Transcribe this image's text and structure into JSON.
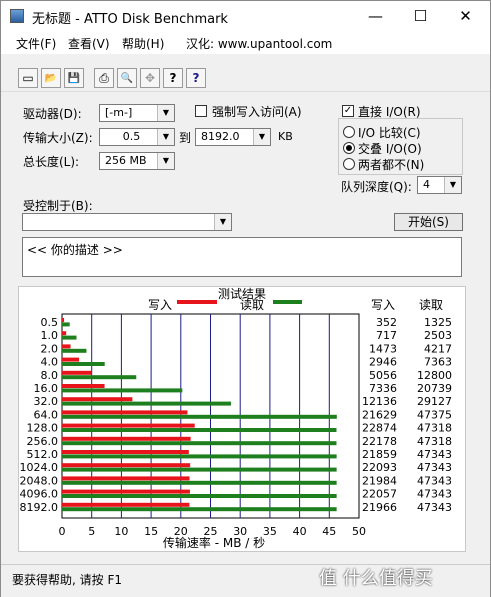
{
  "window": {
    "title": "无标题 - ATTO Disk Benchmark",
    "minimize": "—",
    "maximize": "☐",
    "close": "✕"
  },
  "menu": [
    "文件(F)",
    "查看(V)",
    "帮助(H)",
    "汉化: www.upantool.com"
  ],
  "toolbar": {
    "icons": [
      "new-icon",
      "open-icon",
      "save-icon",
      "print-icon",
      "print-preview-icon",
      "move-icon",
      "help-icon",
      "context-help-icon"
    ],
    "glyphs": [
      "▭",
      "📂",
      "💾",
      "⎙",
      "🔍",
      "✥",
      "?",
      "?"
    ]
  },
  "settings": {
    "drive_label": "驱动器(D):",
    "drive_value": "[-m-]",
    "force_write_label": "强制写入访问(A)",
    "transfer_label": "传输大小(Z):",
    "transfer_from": "0.5",
    "to_label": "到",
    "transfer_to": "8192.0",
    "unit": "KB",
    "total_label": "总长度(L):",
    "total_value": "256 MB",
    "direct_io_label": "直接 I/O(R)",
    "io_compare_label": "I/O 比较(C)",
    "overlap_label": "交叠 I/O(O)",
    "neither_label": "两者都不(N)",
    "queue_label": "队列深度(Q):",
    "queue_value": "4",
    "controlled_label": "受控制于(B):",
    "controlled_value": "",
    "start_button": "开始(S)",
    "description": "<<  你的描述   >>"
  },
  "results": {
    "title": "测试结果",
    "write_legend": "写入",
    "read_legend": "读取",
    "col_write": "写入",
    "col_read": "读取",
    "xlabel": "传输速率 - MB / 秒",
    "x_ticks": [
      "0",
      "5",
      "10",
      "15",
      "20",
      "25",
      "30",
      "35",
      "40",
      "45",
      "50"
    ],
    "write_color": "#e8141b",
    "read_color": "#1e7f1e"
  },
  "chart_data": {
    "type": "bar",
    "title": "测试结果",
    "xlabel": "传输速率 - MB / 秒",
    "xlim": [
      0,
      50
    ],
    "categories": [
      "0.5",
      "1.0",
      "2.0",
      "4.0",
      "8.0",
      "16.0",
      "32.0",
      "64.0",
      "128.0",
      "256.0",
      "512.0",
      "1024.0",
      "2048.0",
      "4096.0",
      "8192.0"
    ],
    "series": [
      {
        "name": "写入",
        "values": [
          352,
          717,
          1473,
          2946,
          5056,
          7336,
          12136,
          21629,
          22874,
          22178,
          21859,
          22093,
          21984,
          22057,
          21966
        ]
      },
      {
        "name": "读取",
        "values": [
          1325,
          2503,
          4217,
          7363,
          12800,
          20739,
          29127,
          47375,
          47318,
          47318,
          47343,
          47343,
          47343,
          47343,
          47343
        ]
      }
    ]
  },
  "status": {
    "text": "要获得帮助, 请按 F1"
  },
  "watermark": "值 什么值得买"
}
